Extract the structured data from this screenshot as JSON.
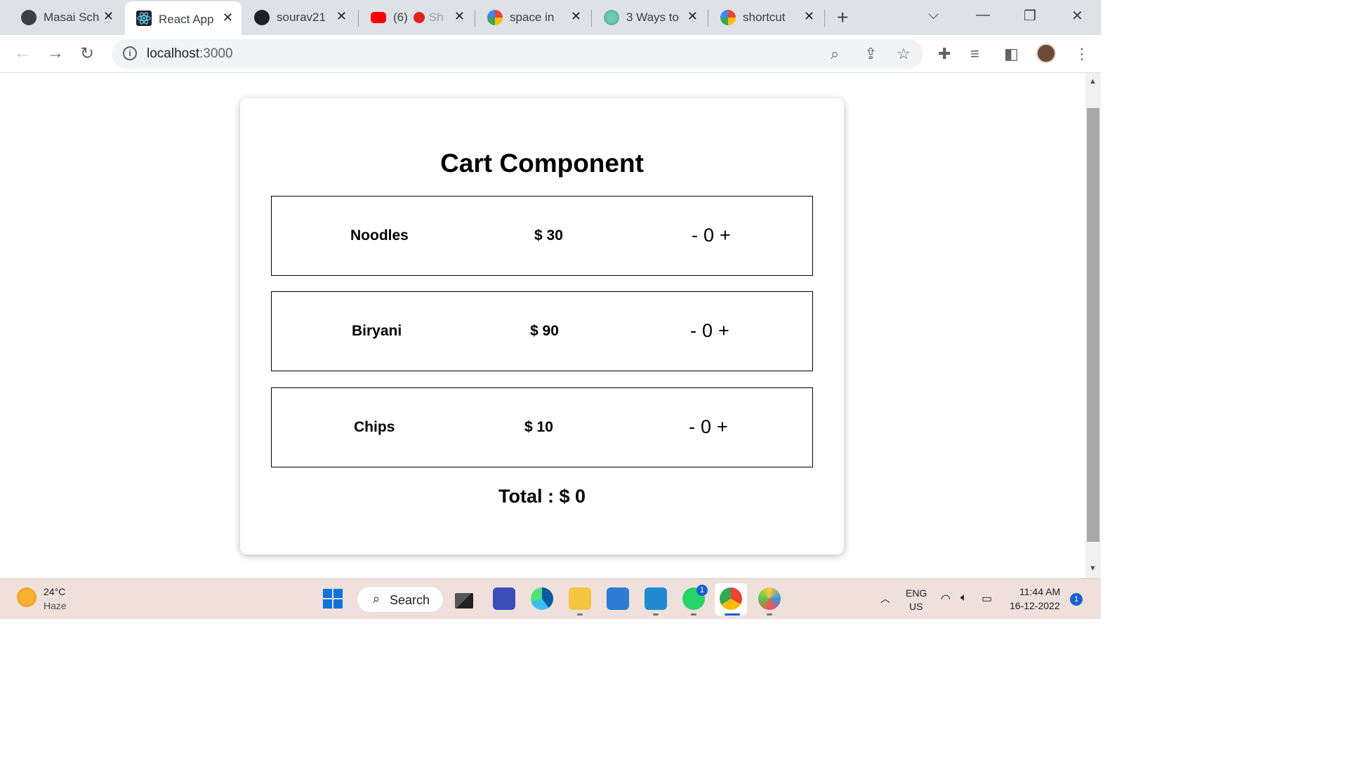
{
  "browser": {
    "tabs": [
      {
        "label": "Masai School",
        "active": false,
        "icon": "globe-icon"
      },
      {
        "label": "React App",
        "active": true,
        "icon": "react-icon"
      },
      {
        "label": "sourav21",
        "active": false,
        "icon": "github-icon"
      },
      {
        "label": "(6)",
        "extra": "Sh",
        "active": false,
        "icon": "youtube-icon"
      },
      {
        "label": "space in",
        "active": false,
        "icon": "google-icon"
      },
      {
        "label": "3 Ways to",
        "active": false,
        "icon": "web-icon"
      },
      {
        "label": "shortcut",
        "active": false,
        "icon": "google-icon"
      }
    ],
    "url_host": "localhost",
    "url_port": ":3000"
  },
  "cart": {
    "title": "Cart Component",
    "items": [
      {
        "name": "Noodles",
        "price": "$ 30",
        "minus": "-",
        "qty": "0",
        "plus": "+"
      },
      {
        "name": "Biryani",
        "price": "$ 90",
        "minus": "-",
        "qty": "0",
        "plus": "+"
      },
      {
        "name": "Chips",
        "price": "$ 10",
        "minus": "-",
        "qty": "0",
        "plus": "+"
      }
    ],
    "total_label": "Total :",
    "total_value": "$ 0"
  },
  "taskbar": {
    "weather_temp": "24°C",
    "weather_desc": "Haze",
    "search_label": "Search",
    "whatsapp_badge": "1",
    "lang_line1": "ENG",
    "lang_line2": "US",
    "time": "11:44 AM",
    "date": "16-12-2022",
    "notification_count": "1"
  }
}
